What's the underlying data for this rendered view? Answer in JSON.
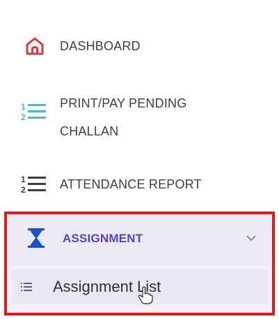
{
  "sidebar": {
    "items": [
      {
        "label": "DASHBOARD",
        "icon": "home-icon",
        "icon_color": "#d83a3a"
      },
      {
        "label_lines": [
          "PRINT/PAY PENDING",
          "CHALLAN"
        ],
        "icon": "numbered-list-icon",
        "icon_color": "#35c3c8"
      },
      {
        "label": "ATTENDANCE REPORT",
        "icon": "numbered-list-icon",
        "icon_color": "#3b3f45"
      },
      {
        "label": "ASSIGNMENT",
        "icon": "hourglass-icon",
        "icon_color": "#1f4fc7",
        "expanded_indicator": "chevron-down-icon",
        "children": [
          {
            "label": "Assignment List",
            "icon": "list-icon"
          }
        ]
      }
    ]
  },
  "colors": {
    "text": "#3b3f45",
    "accent": "#5a3fc0",
    "highlight_border": "#e01b1b",
    "active_bg": "#ebe9f3"
  }
}
